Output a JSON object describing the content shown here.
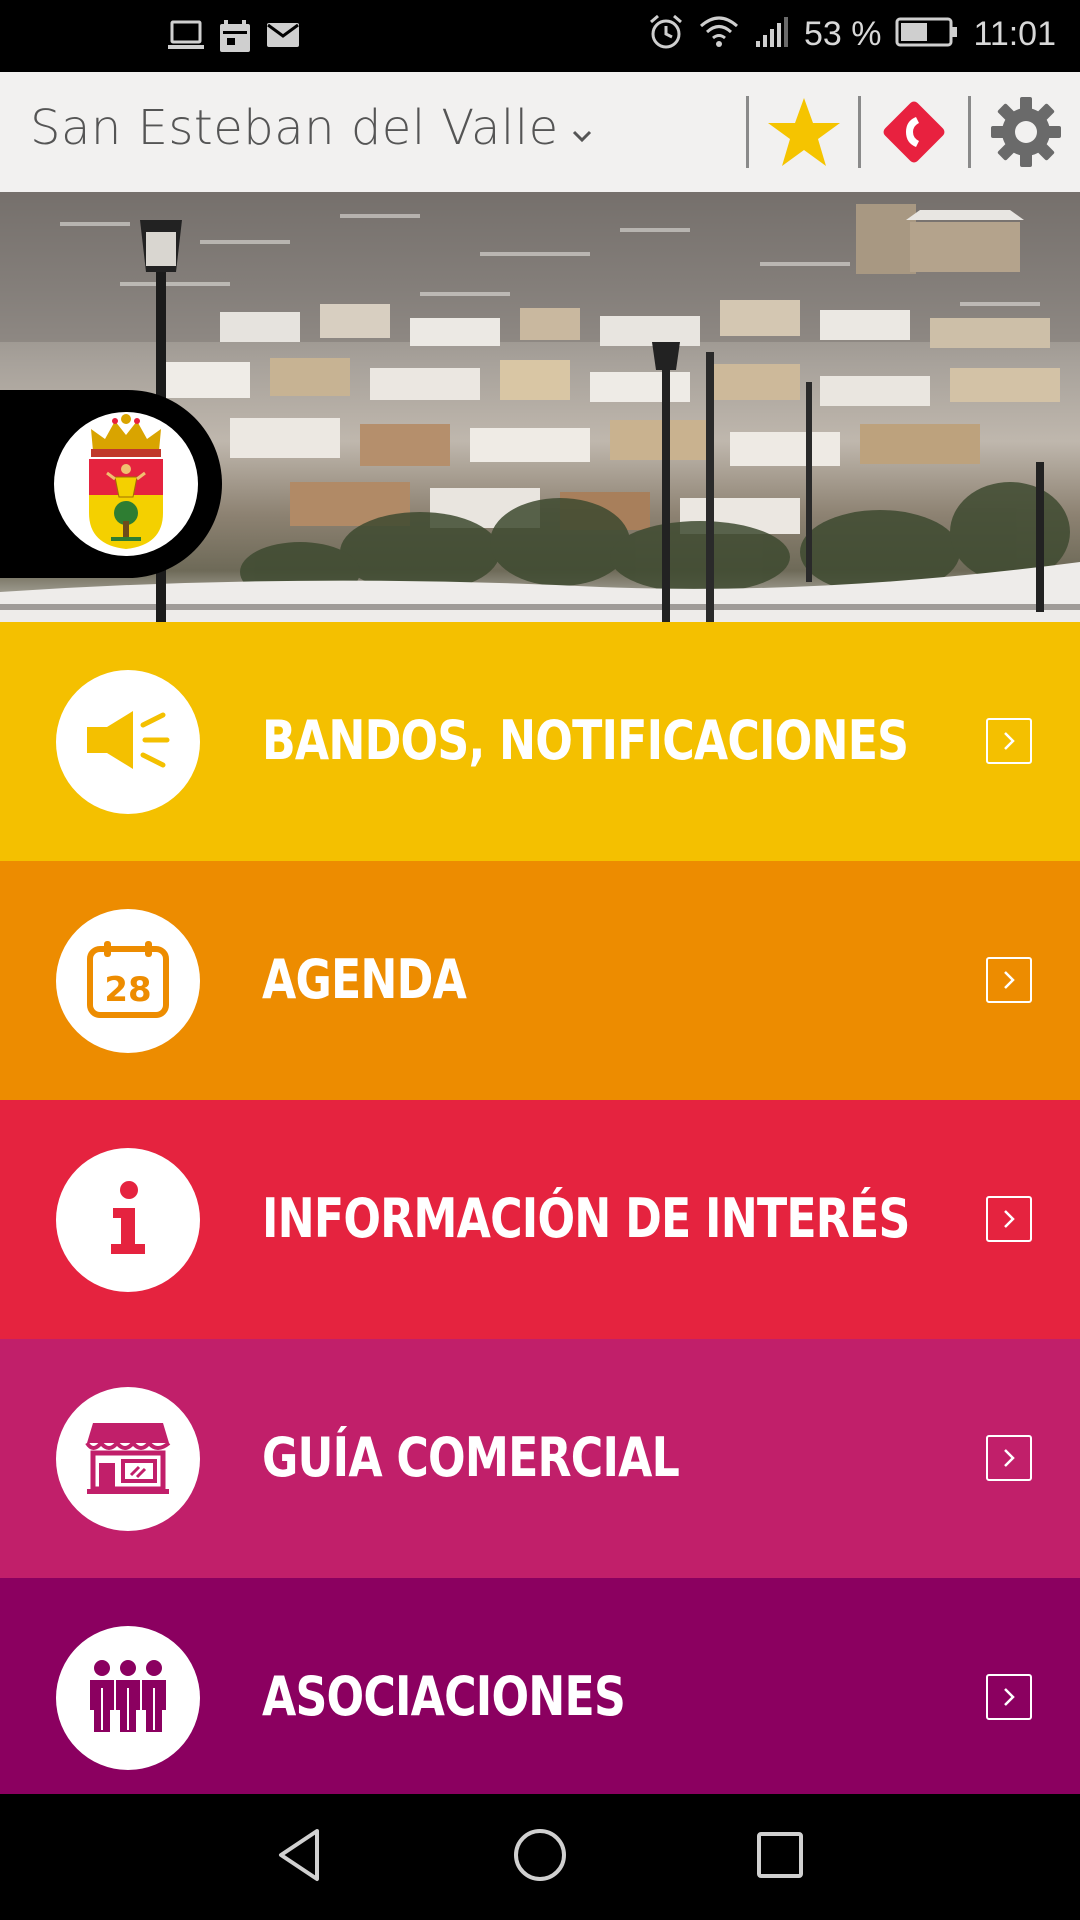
{
  "status_bar": {
    "battery_percent": "53 %",
    "time": "11:01",
    "left_icons": [
      "laptop-icon",
      "calendar-icon",
      "mail-icon"
    ],
    "right_icons": [
      "alarm-icon",
      "wifi-icon",
      "signal-icon",
      "battery-icon"
    ]
  },
  "header": {
    "title": "San Esteban del Valle",
    "actions": [
      "star-icon",
      "phone-icon",
      "gear-icon"
    ],
    "colors": {
      "star": "#f5c400",
      "phone": "#e8213f",
      "gear": "#6a6a6a"
    }
  },
  "hero": {
    "image": "snowy-village-photo",
    "crest": "municipal-coat-of-arms"
  },
  "menu": {
    "items": [
      {
        "label": "BANDOS, NOTIFICACIONES",
        "icon": "megaphone-icon",
        "color": "#f4c000"
      },
      {
        "label": "AGENDA",
        "icon": "calendar-28-icon",
        "color": "#ed8c00",
        "icon_text": "28"
      },
      {
        "label": "INFORMACIÓN DE INTERÉS",
        "icon": "info-icon",
        "color": "#e5233f"
      },
      {
        "label": "GUÍA COMERCIAL",
        "icon": "shop-icon",
        "color": "#c11f6a"
      },
      {
        "label": "ASOCIACIONES",
        "icon": "people-icon",
        "color": "#8b0060"
      }
    ]
  },
  "nav_bar": {
    "buttons": [
      "back-icon",
      "home-icon",
      "recents-icon"
    ]
  }
}
